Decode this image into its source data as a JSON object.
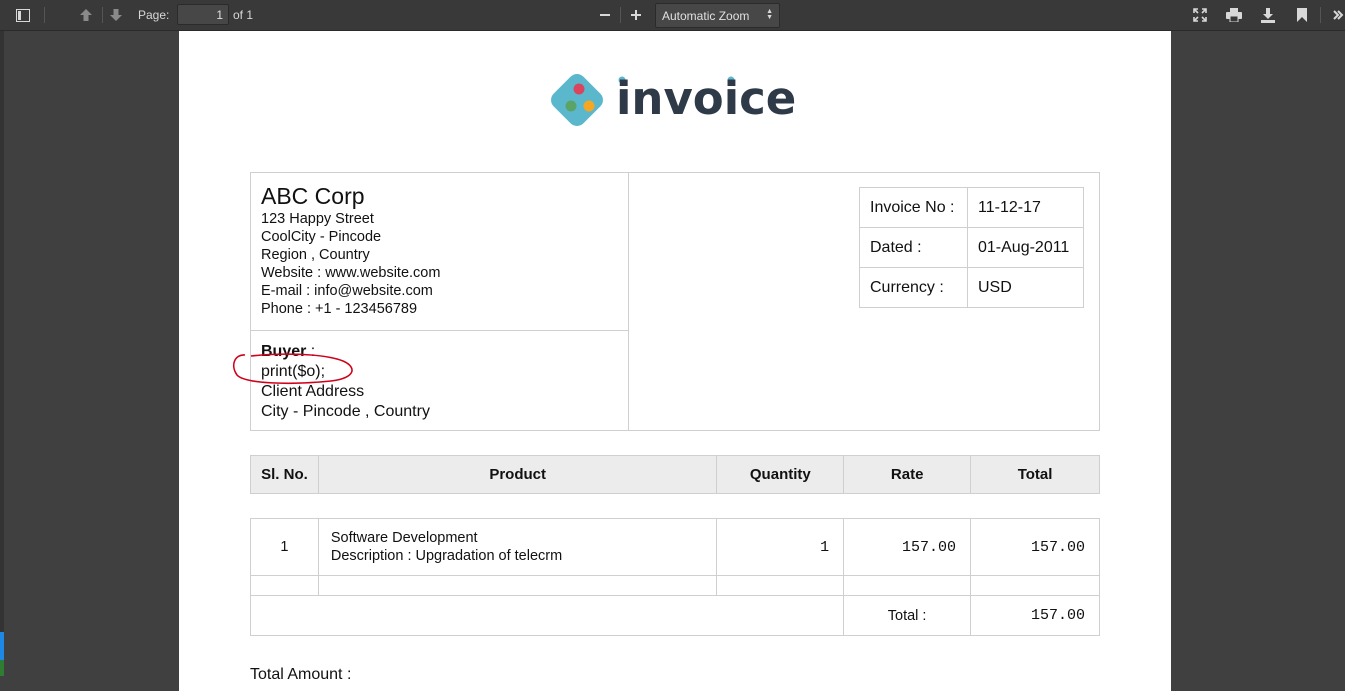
{
  "toolbar": {
    "page_label": "Page:",
    "page_value": "1",
    "page_of": "of 1",
    "zoom_value": "Automatic Zoom",
    "icons": [
      "sidebar-toggle-icon",
      "previous-page-icon",
      "next-page-icon",
      "zoom-out-icon",
      "zoom-in-icon",
      "presentation-mode-icon",
      "print-icon",
      "download-icon",
      "bookmark-icon",
      "tools-icon"
    ]
  },
  "invoice": {
    "logo_text": "invoice",
    "seller": {
      "name": "ABC Corp",
      "street": "123 Happy Street",
      "city": "CoolCity - Pincode",
      "region": "Region , Country",
      "website": "Website : www.website.com",
      "email": "E-mail : info@website.com",
      "phone": "Phone : +1 - 123456789"
    },
    "buyer": {
      "label": "Buyer",
      "label_suffix": " :",
      "name": "print($o);",
      "address": "Client Address",
      "city": "City - Pincode , Country"
    },
    "meta": [
      {
        "key": "Invoice No :",
        "value": "11-12-17"
      },
      {
        "key": "Dated :",
        "value": "01-Aug-2011"
      },
      {
        "key": "Currency :",
        "value": "USD"
      }
    ],
    "columns": [
      "Sl. No.",
      "Product",
      "Quantity",
      "Rate",
      "Total"
    ],
    "items": [
      {
        "sl": "1",
        "product": "Software Development",
        "description": "Description : Upgradation of telecrm",
        "quantity": "1",
        "rate": "157.00",
        "total": "157.00"
      }
    ],
    "total_label": "Total :",
    "total_value": "157.00",
    "total_amount_label": "Total Amount :"
  },
  "colors": {
    "toolbar_bg": "#393939",
    "logo_diamond": "#5bb8cc",
    "logo_text": "#2f3a48",
    "annotation": "#d0021b"
  }
}
